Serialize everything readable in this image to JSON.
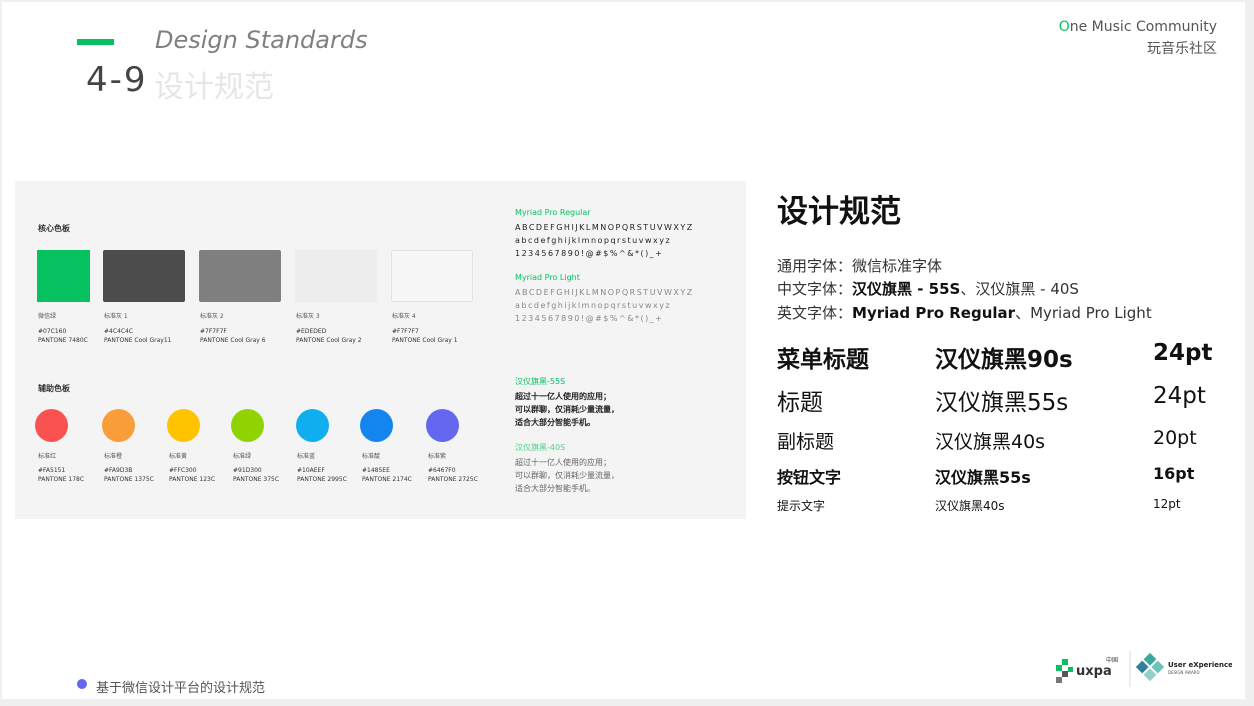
{
  "header": {
    "title_en": "Design Standards",
    "section_number": "4-9",
    "title_cn": "设计规范",
    "brand_en_first": "O",
    "brand_en_rest": "ne Music Community",
    "brand_cn": "玩音乐社区"
  },
  "panel": {
    "core_title": "核心色板",
    "core_colors": [
      {
        "name": "微信绿",
        "hex": "#07C160",
        "pantone": "PANTONE 7480C",
        "color": "#07C160"
      },
      {
        "name": "标准灰 1",
        "hex": "#4C4C4C",
        "pantone": "PANTONE Cool Gray11",
        "color": "#4C4C4C"
      },
      {
        "name": "标准灰 2",
        "hex": "#7F7F7F",
        "pantone": "PANTONE Cool Gray 6",
        "color": "#7F7F7F"
      },
      {
        "name": "标准灰 3",
        "hex": "#EDEDED",
        "pantone": "PANTONE Cool Gray 2",
        "color": "#EDEDED"
      },
      {
        "name": "标准灰 4",
        "hex": "#F7F7F7",
        "pantone": "PANTONE Cool Gray 1",
        "color": "#F7F7F7"
      }
    ],
    "aux_title": "辅助色板",
    "aux_colors": [
      {
        "name": "标准红",
        "hex": "#FA5151",
        "pantone": "PANTONE 178C",
        "color": "#FA5151"
      },
      {
        "name": "标准橙",
        "hex": "#FA9D3B",
        "pantone": "PANTONE 1375C",
        "color": "#FA9D3B"
      },
      {
        "name": "标准黄",
        "hex": "#FFC300",
        "pantone": "PANTONE 123C",
        "color": "#FFC300"
      },
      {
        "name": "标准绿",
        "hex": "#91D300",
        "pantone": "PANTONE 375C",
        "color": "#91D300"
      },
      {
        "name": "标准蓝",
        "hex": "#10AEEF",
        "pantone": "PANTONE 2995C",
        "color": "#10AEEF"
      },
      {
        "name": "标准靛",
        "hex": "#1485EE",
        "pantone": "PANTONE 2174C",
        "color": "#1485EE"
      },
      {
        "name": "标准紫",
        "hex": "#6467F0",
        "pantone": "PANTONE 2725C",
        "color": "#6467F0"
      }
    ],
    "font_regular": {
      "name": "Myriad Pro Regular",
      "upper": "ABCDEFGHIJKLMNOPQRSTUVWXYZ",
      "lower": "abcdefghijklmnopqrstuvwxyz",
      "digits": "1234567890!@#$%^&*()_+"
    },
    "font_light": {
      "name": "Myriad Pro Light",
      "upper": "ABCDEFGHIJKLMNOPQRSTUVWXYZ",
      "lower": "abcdefghijklmnopqrstuvwxyz",
      "digits": "1234567890!@#$%^&*()_+"
    },
    "hy_bold": {
      "name": "汉仪旗黑-55S",
      "lines": [
        "超过十一亿人使用的应用；",
        "可以群聊，仅消耗少量流量，",
        "适合大部分智能手机。"
      ]
    },
    "hy_light": {
      "name": "汉仪旗黑-40S",
      "lines": [
        "超过十一亿人使用的应用；",
        "可以群聊，仅消耗少量流量，",
        "适合大部分智能手机。"
      ]
    }
  },
  "spec": {
    "title": "设计规范",
    "general_label": "通用字体：",
    "general_value": "微信标准字体",
    "cn_label": "中文字体：",
    "cn_value_bold": "汉仪旗黑 - 55S",
    "cn_value_rest": "、汉仪旗黑 - 40S",
    "en_label": "英文字体：",
    "en_value_bold": "Myriad Pro Regular",
    "en_value_rest": "、Myriad Pro Light",
    "rows": [
      {
        "label": "菜单标题",
        "font": "汉仪旗黑90s",
        "size": "24pt"
      },
      {
        "label": "标题",
        "font": "汉仪旗黑55s",
        "size": "24pt"
      },
      {
        "label": "副标题",
        "font": "汉仪旗黑40s",
        "size": "20pt"
      },
      {
        "label": "按钮文字",
        "font": "汉仪旗黑55s",
        "size": "16pt"
      },
      {
        "label": "提示文字",
        "font": "汉仪旗黑40s",
        "size": "12pt"
      }
    ]
  },
  "footer": {
    "text": "基于微信设计平台的设计规范",
    "logo1": "uxpa",
    "logo1_sup": "中国",
    "logo2_line1": "User eXperience",
    "logo2_line2": "DESIGN AWARD"
  }
}
